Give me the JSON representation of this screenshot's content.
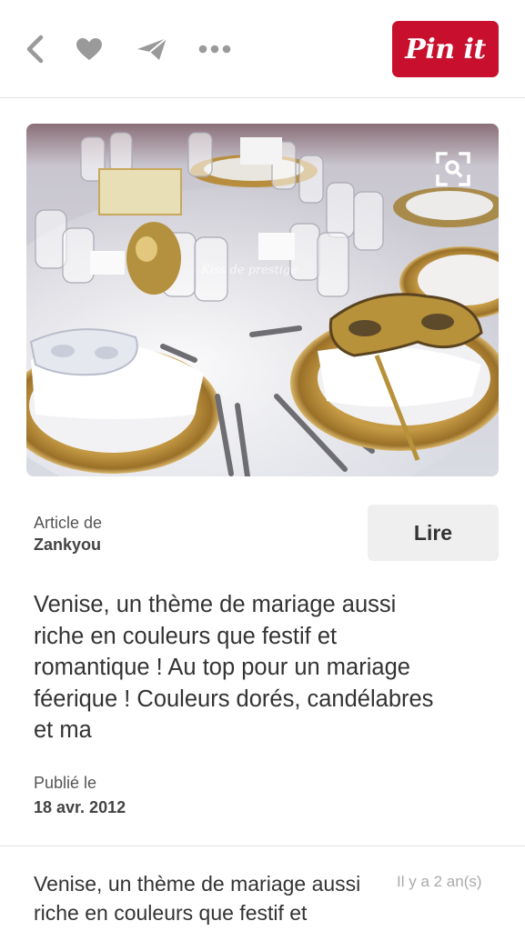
{
  "toolbar": {
    "icons": [
      "back-chevron-icon",
      "heart-icon",
      "send-icon",
      "more-dots-icon"
    ],
    "pin_label": "Pin it",
    "pin_color": "#c8102e"
  },
  "image": {
    "watermark": "Kiss de prestige",
    "lens_icon": "visual-search-icon"
  },
  "source": {
    "label": "Article de",
    "name": "Zankyou",
    "read_label": "Lire"
  },
  "description": "Venise, un thème de mariage aussi riche en couleurs que festif et romantique ! Au top pour un mariage féerique ! Couleurs dorés, candélabres et ma",
  "published": {
    "label": "Publié le",
    "date": "18 avr. 2012"
  },
  "comment": {
    "text": "Venise, un thème de mariage aussi riche en couleurs que festif et",
    "time_ago": "Il y a 2 an(s)"
  }
}
